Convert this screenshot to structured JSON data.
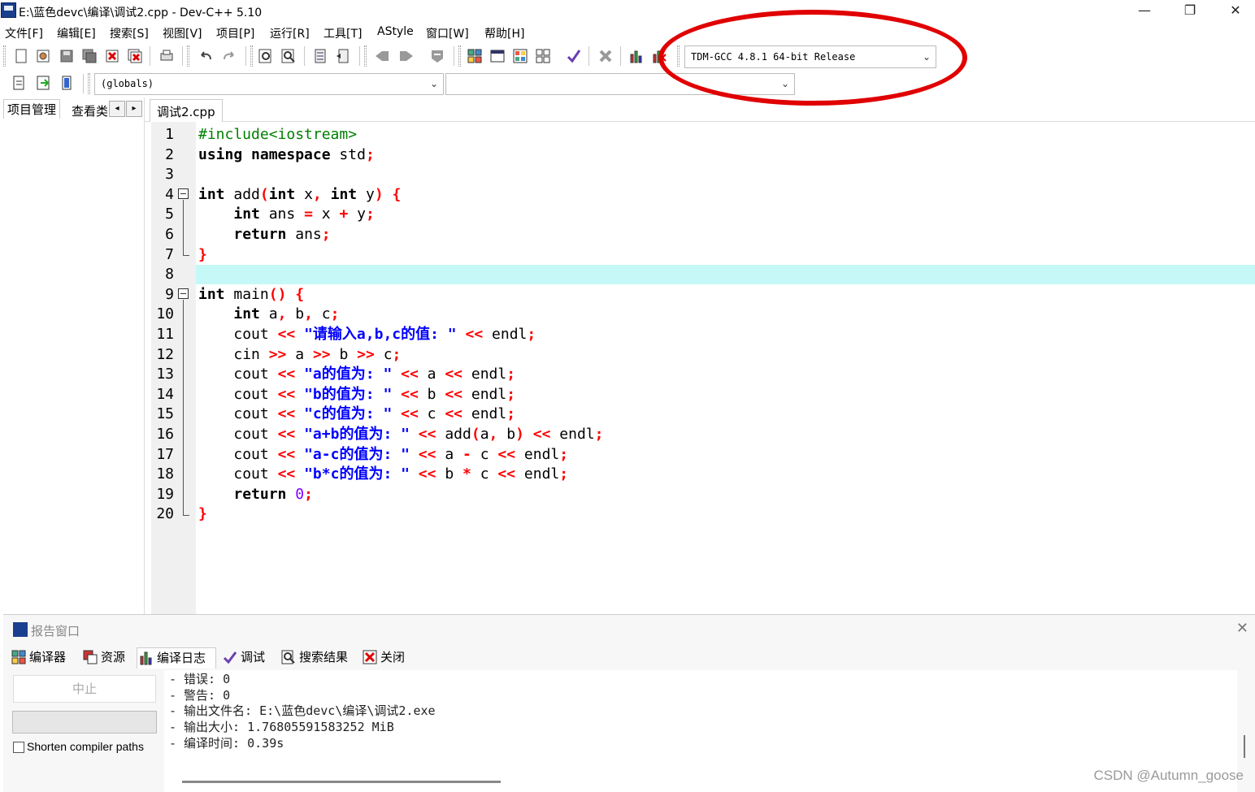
{
  "window": {
    "title": "E:\\蓝色devc\\编译\\调试2.cpp - Dev-C++ 5.10",
    "minimize": "—",
    "restore": "❐",
    "close": "✕"
  },
  "menu": [
    "文件[F]",
    "编辑[E]",
    "搜索[S]",
    "视图[V]",
    "项目[P]",
    "运行[R]",
    "工具[T]",
    "AStyle",
    "窗口[W]",
    "帮助[H]"
  ],
  "toolbar": {
    "compiler_select": "TDM-GCC 4.8.1 64-bit Release",
    "scope_select": "(globals)",
    "member_select": ""
  },
  "left_panel": {
    "tab_project": "项目管理",
    "tab_class": "查看类",
    "prev": "◂",
    "next": "▸"
  },
  "editor": {
    "tab": "调试2.cpp",
    "line_numbers": [
      "1",
      "2",
      "3",
      "4",
      "5",
      "6",
      "7",
      "8",
      "9",
      "10",
      "11",
      "12",
      "13",
      "14",
      "15",
      "16",
      "17",
      "18",
      "19",
      "20"
    ],
    "lines": [
      "#include<iostream>",
      "using namespace std;",
      "",
      "int add(int x, int y) {",
      "    int ans = x + y;",
      "    return ans;",
      "}",
      "",
      "int main() {",
      "    int a, b, c;",
      "    cout << \"请输入a,b,c的值: \" << endl;",
      "    cin >> a >> b >> c;",
      "    cout << \"a的值为: \" << a << endl;",
      "    cout << \"b的值为: \" << b << endl;",
      "    cout << \"c的值为: \" << c << endl;",
      "    cout << \"a+b的值为: \" << add(a, b) << endl;",
      "    cout << \"a-c的值为: \" << a - c << endl;",
      "    cout << \"b*c的值为: \" << b * c << endl;",
      "    return 0;",
      "}"
    ],
    "highlighted_line": 8
  },
  "report": {
    "title": "报告窗口",
    "close": "✕",
    "tabs": [
      "编译器",
      "资源",
      "编译日志",
      "调试",
      "搜索结果",
      "关闭"
    ],
    "stop_button": "中止",
    "shorten_label": "Shorten compiler paths",
    "log": [
      "- 错误: 0",
      "- 警告: 0",
      "- 输出文件名: E:\\蓝色devc\\编译\\调试2.exe",
      "- 输出大小: 1.76805591583252 MiB",
      "- 编译时间: 0.39s"
    ]
  },
  "watermark": "CSDN @Autumn_goose",
  "colors": {
    "annotation": "#e00000",
    "current_line": "#c6f8f8",
    "keyword": "#000000",
    "string": "#0000ff",
    "symbol": "#ff0000",
    "preprocessor": "#008000"
  }
}
